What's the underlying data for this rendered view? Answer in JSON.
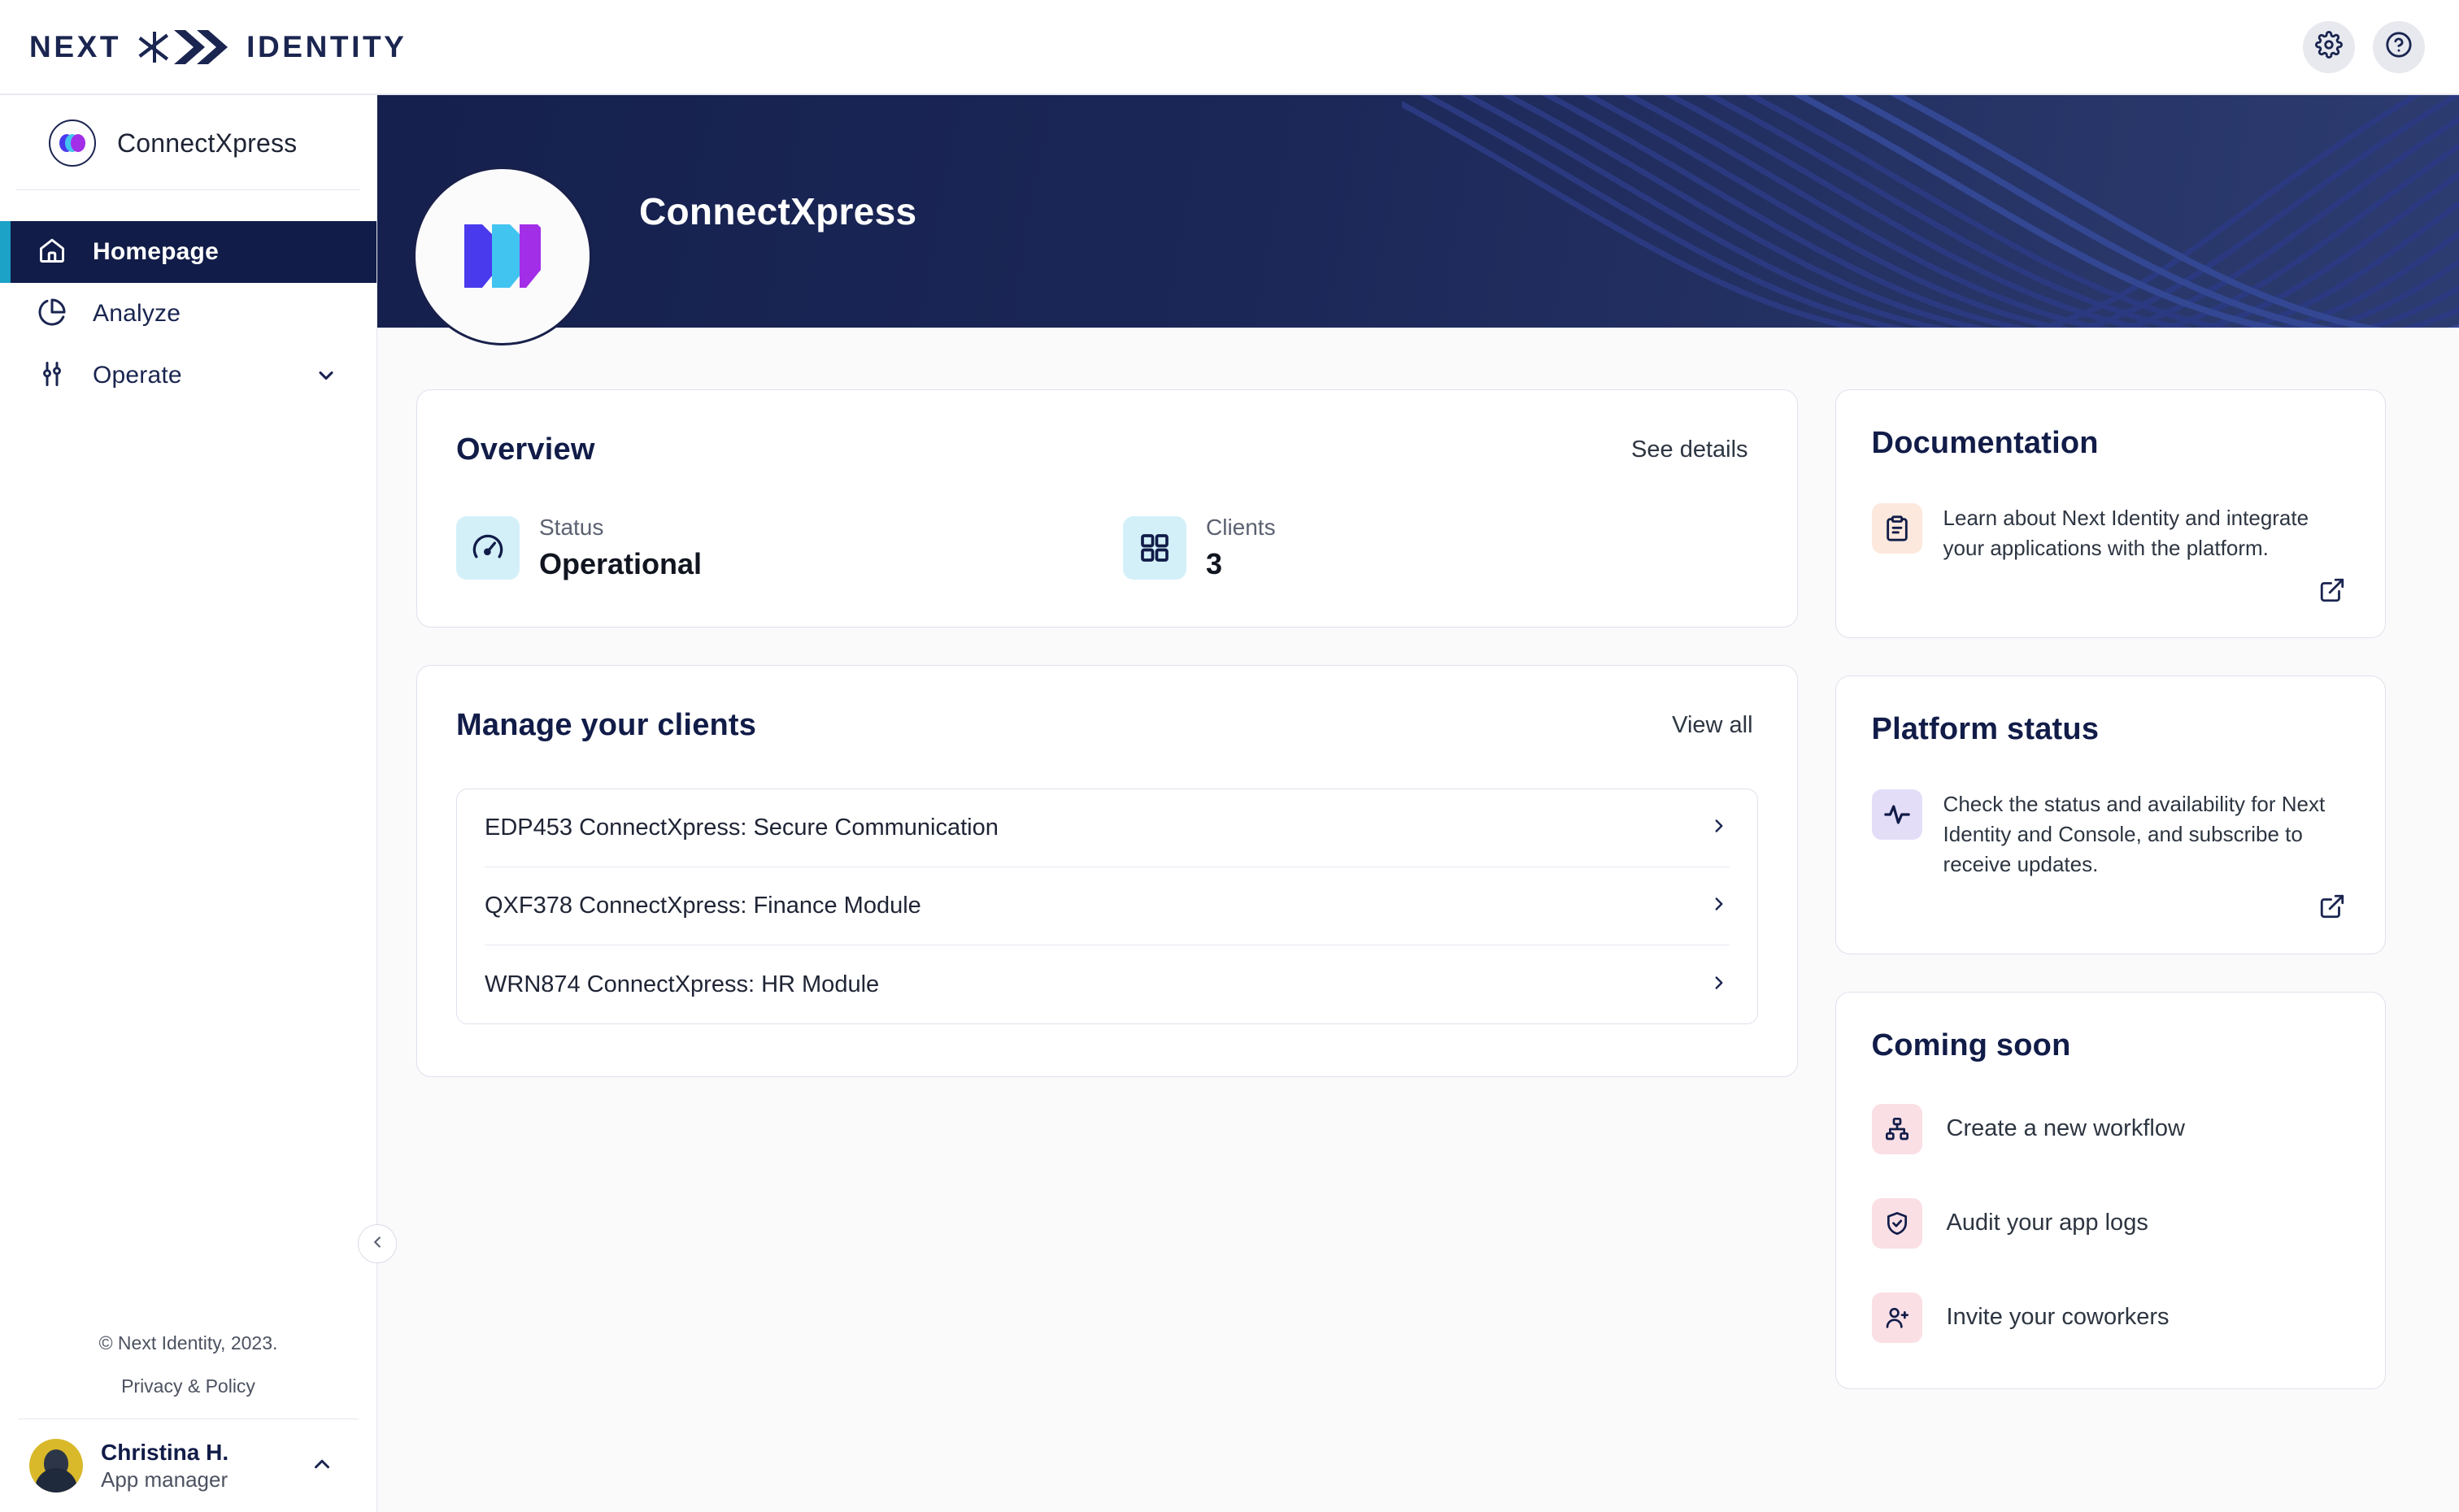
{
  "brand": {
    "word_left": "NEXT",
    "word_right": "IDENTITY",
    "mark": "asterisk-chevrons"
  },
  "topbar": {
    "settings_icon": "gear-icon",
    "help_icon": "question-circle-icon"
  },
  "sidebar": {
    "tenant_name": "ConnectXpress",
    "tenant_logo": "connectxpress-logo",
    "items": [
      {
        "label": "Homepage",
        "icon": "home-icon",
        "active": true,
        "expandable": false
      },
      {
        "label": "Analyze",
        "icon": "pie-chart-icon",
        "active": false,
        "expandable": false
      },
      {
        "label": "Operate",
        "icon": "sliders-icon",
        "active": false,
        "expandable": true
      }
    ],
    "footer": {
      "copyright": "© Next Identity, 2023.",
      "policy": "Privacy & Policy"
    },
    "user": {
      "name": "Christina H.",
      "role": "App manager",
      "avatar": "user-avatar",
      "caret": "chevron-up-icon"
    },
    "collapse_icon": "chevron-left-icon"
  },
  "banner": {
    "title": "ConnectXpress",
    "logo": "connectxpress-logo"
  },
  "overview": {
    "title": "Overview",
    "link": "See details",
    "stats": [
      {
        "label": "Status",
        "value": "Operational",
        "icon": "gauge-icon"
      },
      {
        "label": "Clients",
        "value": "3",
        "icon": "grid-icon"
      }
    ]
  },
  "clients": {
    "title": "Manage your clients",
    "link": "View all",
    "rows": [
      {
        "name": "EDP453 ConnectXpress: Secure Communication",
        "chevron": "chevron-right-icon"
      },
      {
        "name": "QXF378 ConnectXpress: Finance Module",
        "chevron": "chevron-right-icon"
      },
      {
        "name": "WRN874 ConnectXpress: HR Module",
        "chevron": "chevron-right-icon"
      }
    ]
  },
  "documentation": {
    "title": "Documentation",
    "text": "Learn about Next Identity and integrate your applications with the platform.",
    "icon": "clipboard-icon",
    "icon_bg": "#fce8dc",
    "external_icon": "external-link-icon"
  },
  "platform_status": {
    "title": "Platform status",
    "text": "Check the status and availability for Next Identity and Console, and subscribe to receive updates.",
    "icon": "activity-pulse-icon",
    "icon_bg": "#e4ddf8",
    "external_icon": "external-link-icon"
  },
  "coming_soon": {
    "title": "Coming soon",
    "items": [
      {
        "label": "Create a new workflow",
        "icon": "hierarchy-icon"
      },
      {
        "label": "Audit your app logs",
        "icon": "shield-check-icon"
      },
      {
        "label": "Invite your coworkers",
        "icon": "user-plus-icon"
      }
    ]
  },
  "colors": {
    "navy": "#111c48",
    "accent_teal": "#1ba2c6",
    "logo_blue": "#4a3aee",
    "logo_cyan": "#42c4f0",
    "logo_purple": "#a22ee8"
  }
}
